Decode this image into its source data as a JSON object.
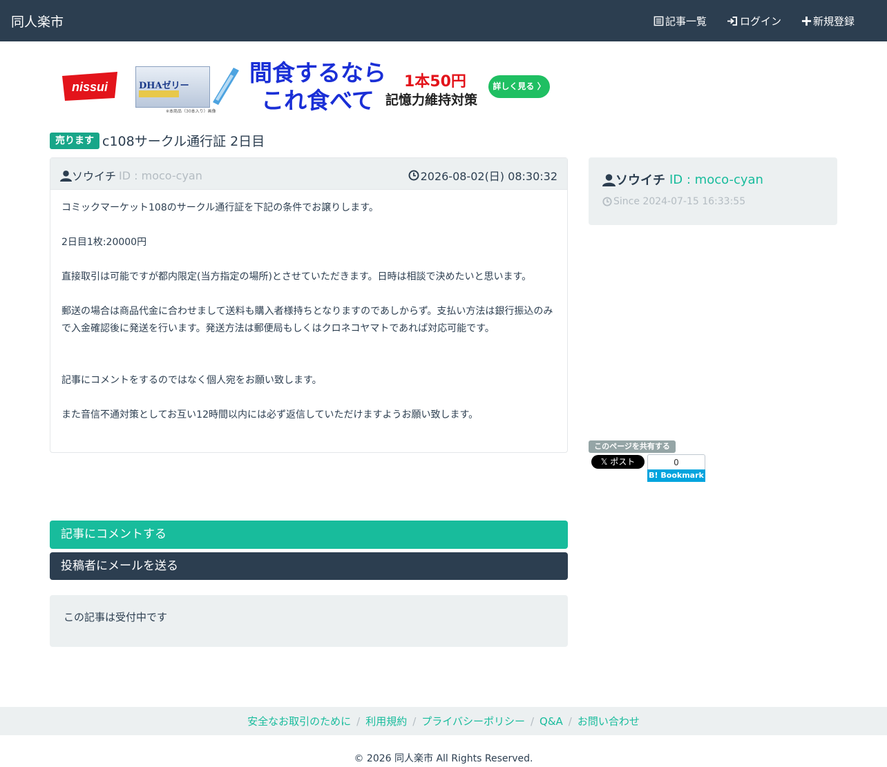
{
  "navbar": {
    "brand": "同人楽市",
    "items": [
      {
        "label": "記事一覧",
        "icon": "list-icon"
      },
      {
        "label": "ログイン",
        "icon": "login-icon"
      },
      {
        "label": "新規登録",
        "icon": "plus-icon"
      }
    ]
  },
  "ad": {
    "logo_text": "nissui",
    "product_label": "DHAゼリー",
    "note": "※本商品（30本入り）画像",
    "headline_line1": "間食するなら",
    "headline_line2": "これ食べて",
    "price": "1本50円",
    "subheadline": "記憶力維持対策",
    "cta": "詳しく見る 〉"
  },
  "post": {
    "label": "売ります",
    "title": "c108サークル通行証 2日目",
    "author_name": "ソウイチ",
    "author_id": "ID : moco-cyan",
    "date": "2026-08-02(日) 08:30:32",
    "body": [
      "コミックマーケット108のサークル通行証を下記の条件でお譲りします。",
      "2日目1枚:20000円",
      "直接取引は可能ですが都内限定(当方指定の場所)とさせていただきます。日時は相談で決めたいと思います。",
      "郵送の場合は商品代金に合わせまして送料も購入者様持ちとなりますのであしからず。支払い方法は銀行振込のみで入金確認後に発送を行います。発送方法は郵便局もしくはクロネコヤマトであれば対応可能です。",
      "記事にコメントをするのではなく個人宛をお願い致します。",
      "また音信不通対策としてお互い12時間以内には必ず返信していただけますようお願い致します。"
    ]
  },
  "profile": {
    "name": "ソウイチ",
    "id": "ID : moco-cyan",
    "since": "Since 2024-07-15 16:33:55"
  },
  "share": {
    "label": "このページを共有する",
    "x_post": "𝕏 ポスト",
    "hatena_count": "0",
    "hatena_label": "B! Bookmark"
  },
  "actions": {
    "comment": "記事にコメントする",
    "mail": "投稿者にメールを送る"
  },
  "status": "この記事は受付中です",
  "footer": {
    "links": [
      "安全なお取引のために",
      "利用規約",
      "プライバシーポリシー",
      "Q&A",
      "お問い合わせ"
    ],
    "copyright": "© 2026 同人楽市 All Rights Reserved."
  },
  "colors": {
    "navbar": "#2c3e50",
    "accent": "#18bc9c",
    "sell_label": "#18a689",
    "panel_bg": "#ecf0f1",
    "muted": "#b4bcc2"
  }
}
